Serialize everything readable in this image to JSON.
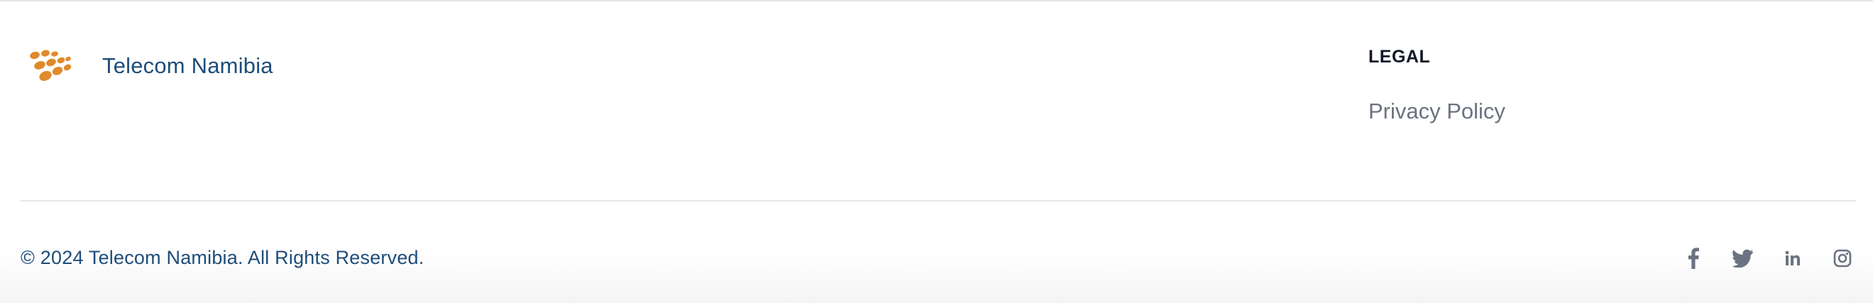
{
  "brand": {
    "name": "Telecom Namibia",
    "logo_icon": "telecom-namibia-dots-logo",
    "logo_color": "#e08a2c"
  },
  "legal": {
    "heading": "LEGAL",
    "links": [
      {
        "label": "Privacy Policy"
      }
    ]
  },
  "footer": {
    "copyright": "© 2024 Telecom Namibia. All Rights Reserved.",
    "social_icons": [
      "facebook-icon",
      "twitter-icon",
      "linkedin-icon",
      "instagram-icon"
    ]
  },
  "colors": {
    "brand_text": "#1d4d7a",
    "link_gray": "#6b7280",
    "heading": "#111827",
    "divider": "#e5e7eb"
  }
}
